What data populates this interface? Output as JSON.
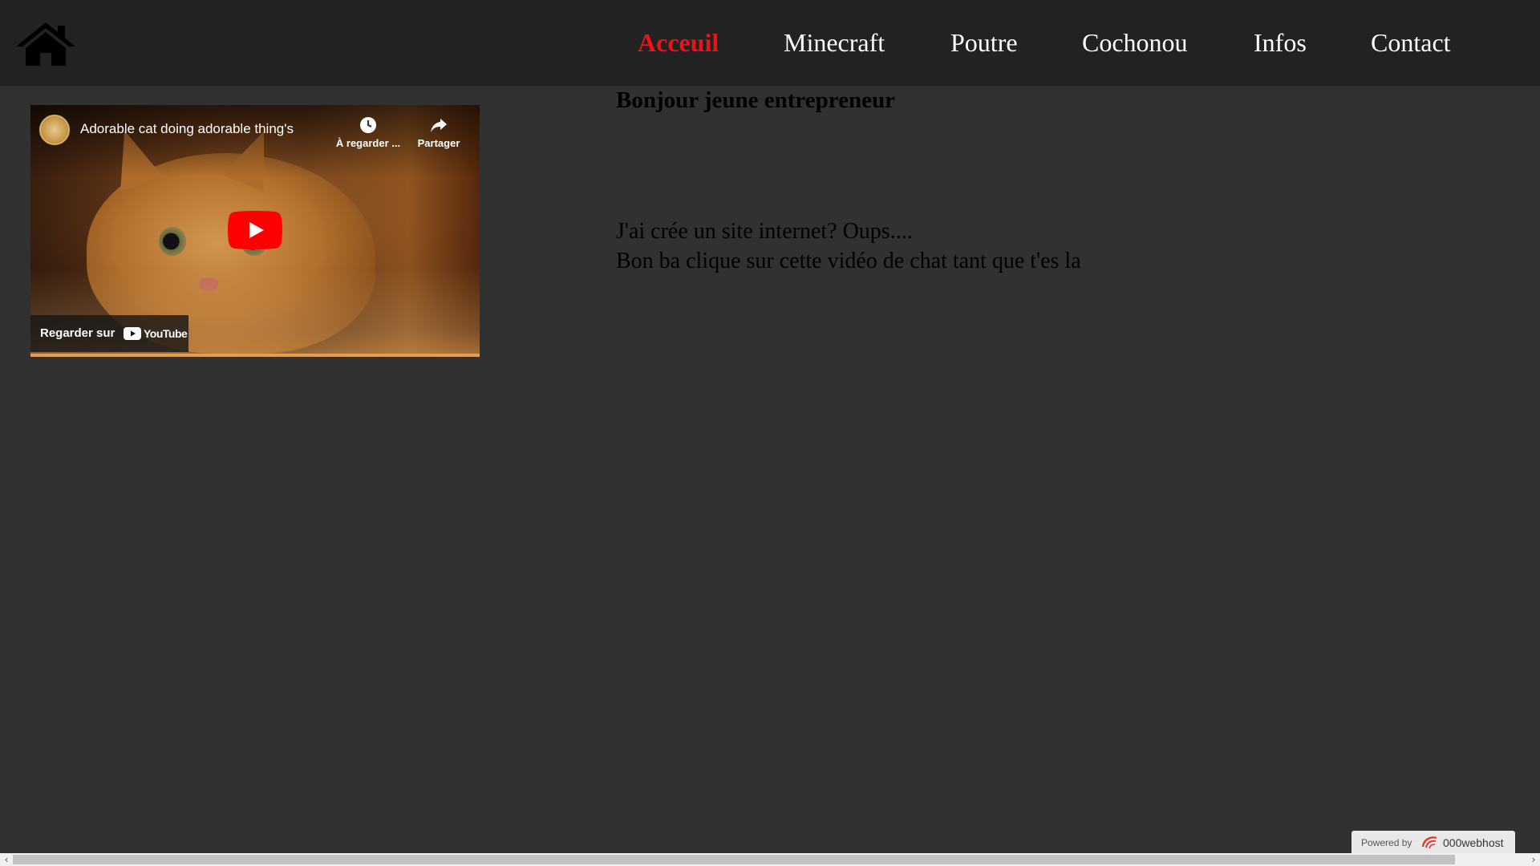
{
  "header": {
    "home_icon": "home-icon",
    "nav": [
      {
        "label": "Acceuil",
        "active": true
      },
      {
        "label": "Minecraft",
        "active": false
      },
      {
        "label": "Poutre",
        "active": false
      },
      {
        "label": "Cochonou",
        "active": false
      },
      {
        "label": "Infos",
        "active": false
      },
      {
        "label": "Contact",
        "active": false
      }
    ],
    "active_color": "#e8141b",
    "background": "#222222"
  },
  "video": {
    "title": "Adorable cat doing adorable thing's",
    "watch_later_label": "À regarder ...",
    "share_label": "Partager",
    "watch_on_label": "Regarder sur",
    "youtube_wordmark": "YouTube",
    "icons": [
      "channel-avatar",
      "clock-icon",
      "share-icon",
      "play-icon",
      "youtube-logo-icon"
    ]
  },
  "main": {
    "heading": "Bonjour jeune entrepreneur",
    "paragraph_1": "J'ai crée un site internet? Oups....",
    "paragraph_2": "Bon ba clique sur cette vidéo de chat tant que t'es la"
  },
  "footer": {
    "powered_by": "Powered by",
    "host_name": "000webhost"
  },
  "scrollbar": {
    "left_arrow": "‹",
    "right_arrow": "›"
  },
  "colors": {
    "page_background": "#313131",
    "text": "#000000",
    "youtube_red": "#ff0000"
  }
}
